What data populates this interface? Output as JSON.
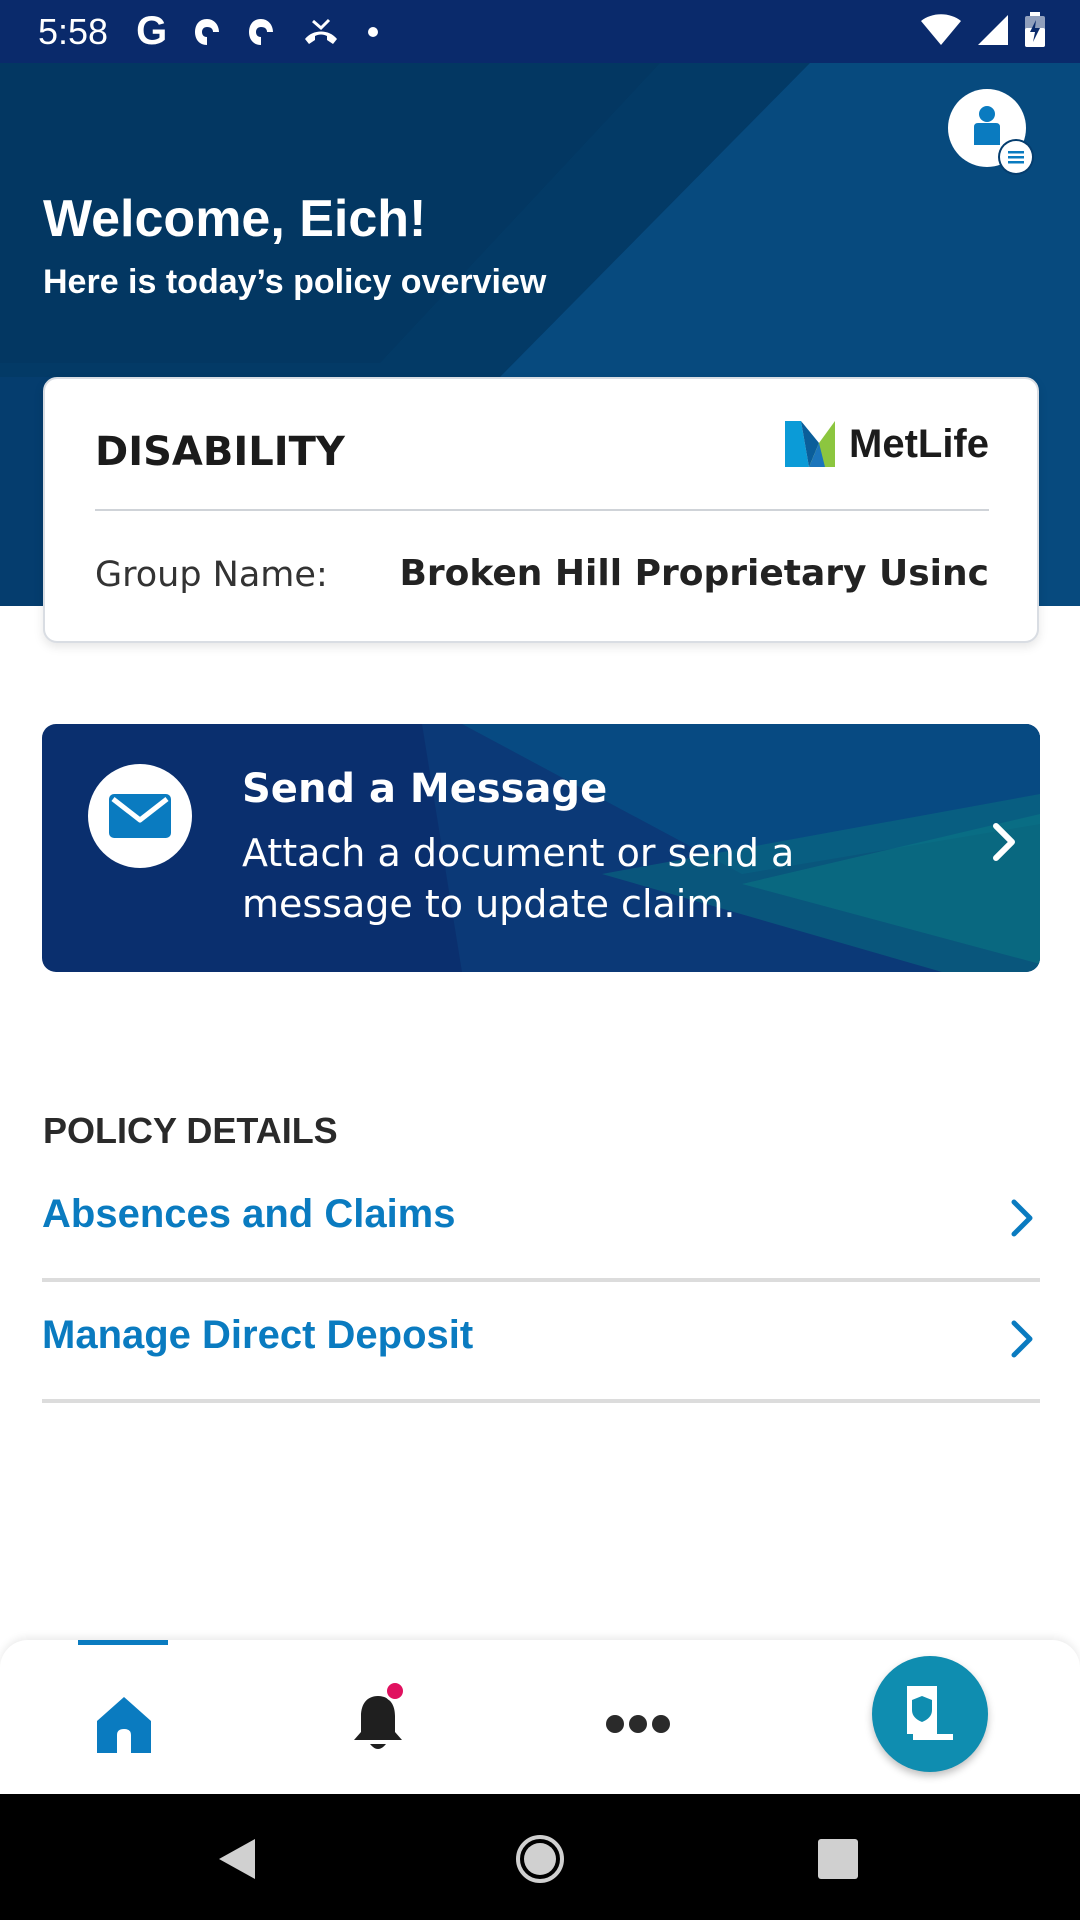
{
  "status_bar": {
    "time": "5:58",
    "icons": [
      "google-icon",
      "pager-icon",
      "pager-icon",
      "missed-call-icon",
      "dot-icon",
      "wifi-icon",
      "signal-icon",
      "battery-icon"
    ]
  },
  "header": {
    "welcome": "Welcome, Eich!",
    "subtitle": "Here is today’s policy overview",
    "avatar_icon": "profile-menu-icon"
  },
  "policy_card": {
    "type": "DISABILITY",
    "brand": "MetLife",
    "group_label": "Group Name:",
    "group_value": "Broken Hill Proprietary Usinc"
  },
  "message_banner": {
    "title": "Send a Message",
    "body": "Attach a document or send a message to update claim.",
    "icon": "mail-icon"
  },
  "policy_details": {
    "section_title": "POLICY DETAILS",
    "items": [
      {
        "label": "Absences and Claims"
      },
      {
        "label": "Manage Direct Deposit"
      }
    ]
  },
  "bottom_nav": {
    "items": [
      "home-icon",
      "bell-icon",
      "more-icon",
      "id-card-icon"
    ],
    "active": "home",
    "notification_badge": true
  },
  "colors": {
    "header_bg": "#053d6e",
    "status_bar_bg": "#0a2a6b",
    "accent_blue": "#0a7bc0",
    "banner_bg": "#0a2f6e",
    "fab_bg": "#0f8db0",
    "badge_red": "#e0115f"
  }
}
